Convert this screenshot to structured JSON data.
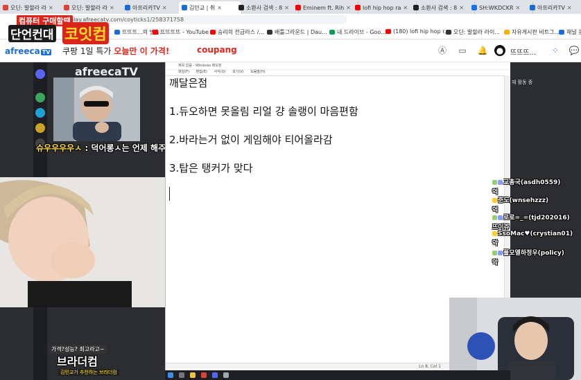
{
  "browser": {
    "tabs": [
      {
        "label": "오딘: 발할라 라",
        "color": "#db4437"
      },
      {
        "label": "오딘: 발할라 라",
        "color": "#db4437"
      },
      {
        "label": "아프리카TV",
        "color": "#1a6dd6"
      },
      {
        "label": "김민교 | 취",
        "color": "#1a6dd6",
        "active": true
      },
      {
        "label": "소환사 검색 : 8",
        "color": "#222222"
      },
      {
        "label": "Eminem ft. Rih",
        "color": "#ff0000"
      },
      {
        "label": "lofi hip hop ra",
        "color": "#ff0000"
      },
      {
        "label": "소환사 검색 : 8",
        "color": "#222222"
      },
      {
        "label": "SH:WKDCKR",
        "color": "#1a73e8"
      },
      {
        "label": "아프리카TV",
        "color": "#1a6dd6"
      }
    ],
    "url": "play.afreecatv.com/coyticks1/258371758",
    "bookmarks": [
      {
        "label": "뜨뜨뜨...의 방송...",
        "color": "#1a6dd6"
      },
      {
        "label": "뜨뜨뜨뜨 - YouTube",
        "color": "#ff0000"
      },
      {
        "label": "승리의 전급라스 /...",
        "color": "#ff0000"
      },
      {
        "label": "배틀그라운드 | Dau...",
        "color": "#333333"
      },
      {
        "label": "내 드라이브 - Goo...",
        "color": "#0f9d58"
      },
      {
        "label": "(180) lofi hip hop r...",
        "color": "#ff0000"
      },
      {
        "label": "오딘: 발할라 라이...",
        "color": "#333333"
      },
      {
        "label": "자유게시판 비트그...",
        "color": "#f4b400"
      },
      {
        "label": "채널 원",
        "color": "#1a6dd6"
      }
    ]
  },
  "header": {
    "logo": "afreeca",
    "logo_tv": "TV",
    "promo_prefix": "쿠팡 1일 특가 ",
    "promo_highlight": "오늘만 이 가격!",
    "coupang": "coupang",
    "user_nick": "뜨뜨뜨..."
  },
  "overlay": {
    "channel_logo_line1": "컴퓨터 구매할땐",
    "channel_logo_line2": "단언컨대",
    "channel_logo_line3": "코잇컴",
    "watermark": "afreecaTV",
    "donation_nick": "슈우우우우ㅅ",
    "donation_msg": ": 덕어롱ㅅ는 언제 해주니",
    "badge_top": "가격?성능? 최고라고~",
    "badge_name": "브라더컴",
    "badge_sub": "김민교가 추천하는 브라더컴"
  },
  "notepad": {
    "title": "제목 없음 - Windows 메모장",
    "menu": [
      "파일(F)",
      "편집(E)",
      "서식(O)",
      "보기(V)",
      "도움말(H)"
    ],
    "lines": [
      "깨달은점",
      "1.듀오하면 못올림 리얼 걍 솔랭이 마음편함",
      "2.바라는거 없이 게임해야 티어올라감",
      "3.탑은 탱커가 맞다"
    ],
    "status": "Ln 8, Col 1"
  },
  "right_panel": {
    "header": "재 활동 중"
  },
  "chat": [
    {
      "user": "교총국(asdh0559)",
      "text": "억"
    },
    {
      "user": "준도(wnsehzzz)",
      "text": "억"
    },
    {
      "user": "로로=_=(tjd202016)",
      "text": "뜨이쥬"
    },
    {
      "user": "SsoMac♥(crystian01)",
      "text": "악"
    },
    {
      "user": "폴모엘하정우(policy)",
      "text": "악"
    }
  ]
}
